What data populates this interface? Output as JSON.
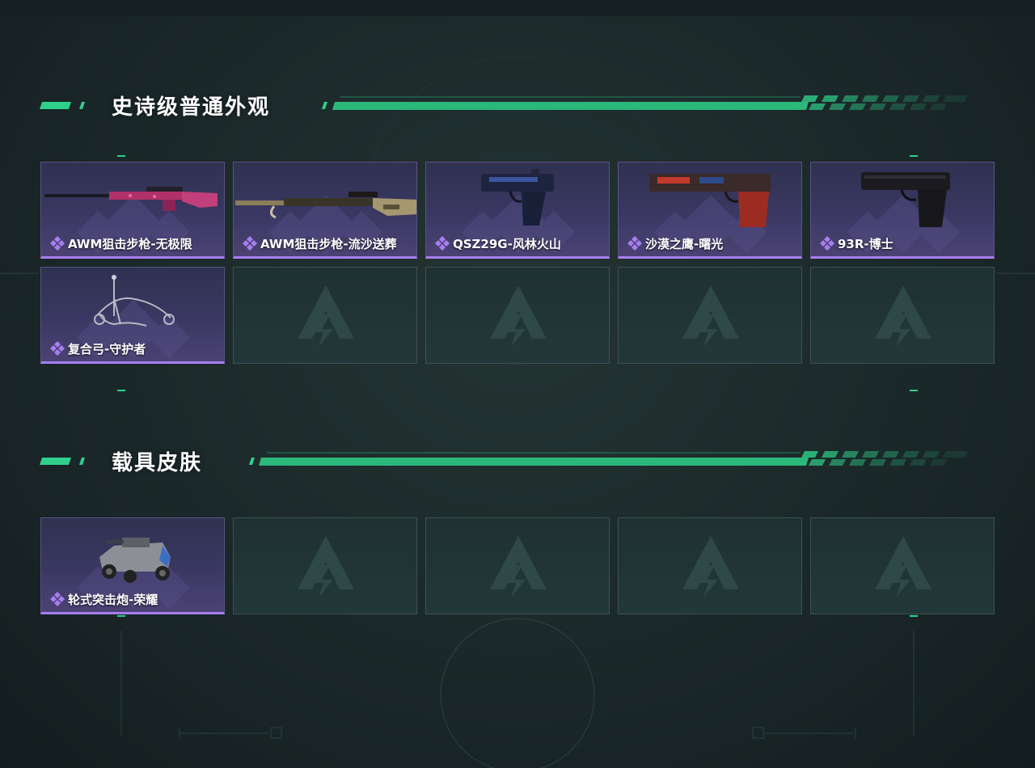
{
  "sections": [
    {
      "title": "史诗级普通外观",
      "items": [
        {
          "label": "AWM狙击步枪-无极限",
          "art": "sniper-rifle-pink"
        },
        {
          "label": "AWM狙击步枪-流沙送葬",
          "art": "sniper-rifle-gold"
        },
        {
          "label": "QSZ29G-风林火山",
          "art": "pistol-blue"
        },
        {
          "label": "沙漠之鹰-曙光",
          "art": "pistol-red"
        },
        {
          "label": "93R-博士",
          "art": "pistol-black"
        },
        {
          "label": "复合弓-守护者",
          "art": "compound-bow"
        }
      ],
      "empty_slots": 4
    },
    {
      "title": "载具皮肤",
      "items": [
        {
          "label": "轮式突击炮-荣耀",
          "art": "armored-vehicle"
        }
      ],
      "empty_slots": 4
    }
  ],
  "theme": {
    "accent": "#2fd08a",
    "rarity": "#a77ef0",
    "card_filled": "#3a3863",
    "card_empty": "#223838"
  }
}
